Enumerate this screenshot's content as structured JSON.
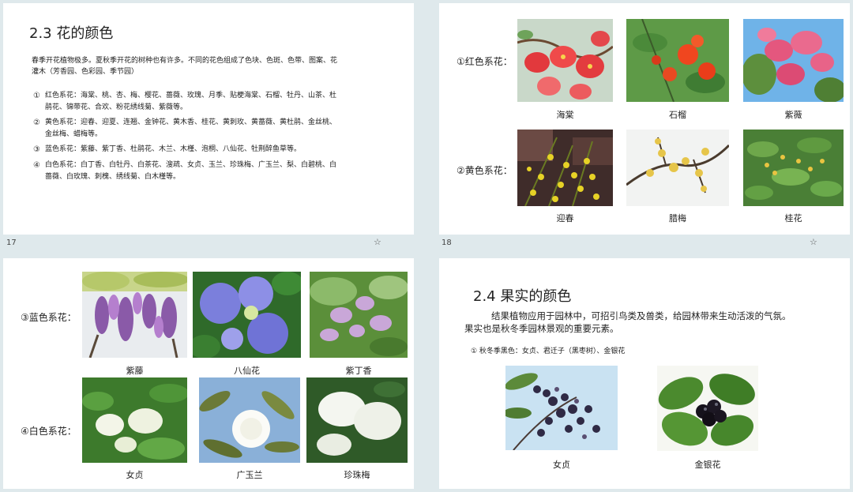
{
  "slides": {
    "s17": {
      "page_number": "17",
      "title": "2.3 花的颜色",
      "intro_line1": "春季开花植物极多。夏秋季开花的树种也有许多。不同的花色组成了色块、色斑、色带、图案、花",
      "intro_line2": "灌木（芳香园、色彩园、季节园）",
      "items": [
        {
          "marker": "①",
          "line1": "红色系花：海棠、桃、杏、梅、樱花、蔷薇、玫瑰、月季、贴梗海棠、石榴、牡丹、山茶、杜",
          "line2": "鹃花、锦带花、合欢、粉花绣线菊、紫薇等。"
        },
        {
          "marker": "②",
          "line1": "黄色系花：迎春、迎夏、连翘、金钟花、黄木香、桂花、黄刺玫、黄蔷薇、黄杜鹃、金丝桃、",
          "line2": "金丝梅、蜡梅等。"
        },
        {
          "marker": "③",
          "line1": "蓝色系花：紫藤、紫丁香、杜鹃花、木兰、木槿、泡桐、八仙花、牡荆醉鱼草等。",
          "line2": ""
        },
        {
          "marker": "④",
          "line1": "白色系花：白丁香、白牡丹、白茶花、溲疏、女贞、玉兰、珍珠梅、广玉兰、梨、白碧桃、白",
          "line2": "蔷薇、白玫瑰、刺槐、绣线菊、白木槿等。"
        }
      ]
    },
    "s18": {
      "page_number": "18",
      "row1_label": "①红色系花：",
      "row2_label": "②黄色系花：",
      "row1_captions": [
        "海棠",
        "石榴",
        "紫薇"
      ],
      "row2_captions": [
        "迎春",
        "腊梅",
        "桂花"
      ]
    },
    "s19": {
      "row1_label": "③蓝色系花：",
      "row2_label": "④白色系花：",
      "row1_captions": [
        "紫藤",
        "八仙花",
        "紫丁香"
      ],
      "row2_captions": [
        "女贞",
        "广玉兰",
        "珍珠梅"
      ]
    },
    "s20": {
      "title": "2.4 果实的颜色",
      "body_line1": "结果植物应用于园林中，可招引鸟类及兽类，给园林带来生动活泼的气氛。",
      "body_line2": "果实也是秋冬季园林景观的重要元素。",
      "item": "① 秋冬季黑色：女贞、君迁子（黑枣树）、金银花",
      "captions": [
        "女贞",
        "金银花"
      ]
    }
  },
  "icons": {
    "star": "☆"
  }
}
